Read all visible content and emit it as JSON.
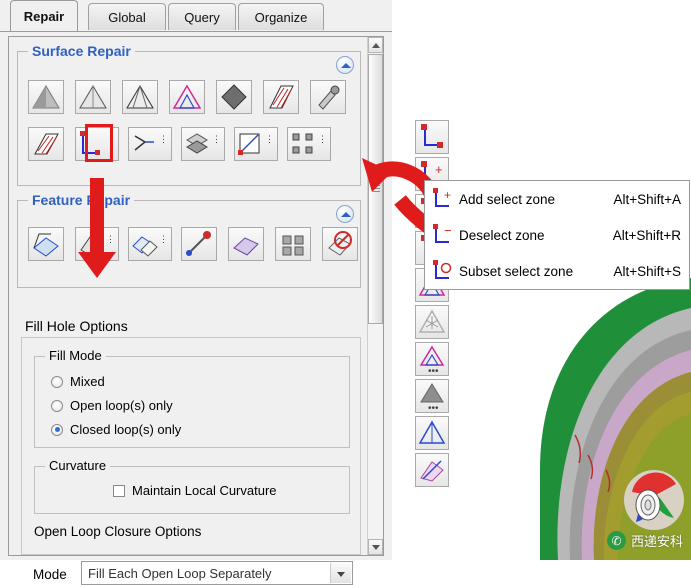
{
  "tabs": [
    {
      "label": "Repair",
      "active": true
    },
    {
      "label": "Global",
      "active": false
    },
    {
      "label": "Query",
      "active": false
    },
    {
      "label": "Organize",
      "active": false
    }
  ],
  "surface_repair": {
    "title": "Surface Repair",
    "collapse_icon": "chevron-up-circle-icon",
    "row1_icons": [
      "shade-surfaces-icon",
      "single-surface-icon",
      "surface-edges-icon",
      "triangle-mesh-icon",
      "diamond-patch-icon",
      "hatched-patch-icon",
      "repair-tools-icon"
    ],
    "row2_icons": [
      "hatched-surface-icon",
      "select-zone-icon",
      "edge-split-icon",
      "layered-surface-icon",
      "project-surface-icon",
      "mesh-node-icon"
    ]
  },
  "feature_repair": {
    "title": "Feature Repair",
    "collapse_icon": "chevron-up-circle-icon",
    "icons": [
      "feature-fold-icon",
      "feature-extract-icon",
      "feature-pair-icon",
      "feature-point-icon",
      "feature-plane-icon",
      "feature-grid-icon",
      "feature-delete-icon"
    ]
  },
  "fill_hole_options": {
    "title": "Fill Hole Options",
    "fill_mode": {
      "title": "Fill Mode",
      "options": [
        {
          "label": "Mixed",
          "selected": false
        },
        {
          "label": "Open loop(s) only",
          "selected": false
        },
        {
          "label": "Closed loop(s) only",
          "selected": true
        }
      ]
    },
    "curvature": {
      "title": "Curvature",
      "checkbox_label": "Maintain Local Curvature",
      "checked": false
    },
    "open_loop_closure": {
      "title": "Open Loop Closure Options",
      "mode_label": "Mode",
      "mode_value": "Fill Each Open Loop Separately",
      "dropdown_icon": "chevron-down-icon"
    }
  },
  "context_menu": {
    "items": [
      {
        "icon": "add-select-zone-icon",
        "label": "Add select zone",
        "accel": "Alt+Shift+A"
      },
      {
        "icon": "deselect-zone-icon",
        "label": "Deselect zone",
        "accel": "Alt+Shift+R"
      },
      {
        "icon": "subset-select-zone-icon",
        "label": "Subset select zone",
        "accel": "Alt+Shift+S"
      }
    ]
  },
  "vertical_toolbar": {
    "buttons": [
      "select-zone-icon",
      "add-select-zone-icon",
      "deselect-zone-icon",
      "subset-select-zone-icon",
      "triangle-pink-icon",
      "triangle-star-icon",
      "triangle-pink-dots-icon",
      "triangle-gray-dots-icon",
      "triangle-outline-icon",
      "arrow-patch-icon"
    ]
  },
  "annotations": {
    "highlight_box_icon": "red-highlight-rectangle",
    "arrow_down_icon": "red-down-arrow",
    "arrow_curve_icon": "red-curved-arrow",
    "accent_color": "#e01b1b"
  },
  "watermark": {
    "logo_icon": "wechat-logo-icon",
    "text": "西递安科"
  },
  "scrollbar": {
    "up_icon": "scroll-up-arrow-icon",
    "down_icon": "scroll-down-arrow-icon",
    "thumb_icon": "scroll-thumb"
  }
}
